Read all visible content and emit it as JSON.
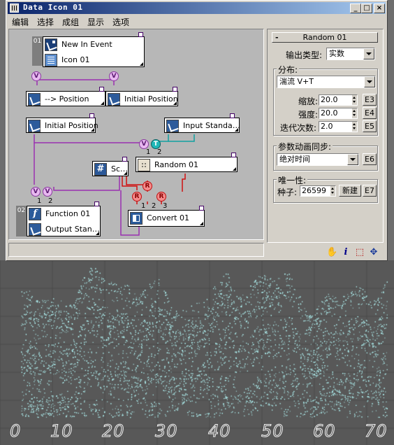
{
  "window": {
    "title": "Data Icon 01"
  },
  "menu": [
    "编辑",
    "选择",
    "成组",
    "显示",
    "选项"
  ],
  "graph": {
    "groups": [
      "01",
      "02"
    ],
    "nodes": {
      "new_in_event": "New In Event",
      "icon01": "Icon 01",
      "position": "--> Position",
      "initial_position_top": "Initial Position",
      "initial_position_left": "Initial Position",
      "input_standard": "Input Standa…",
      "scalar": "Sc…",
      "random": "Random 01",
      "function": "Function 01",
      "output_standard": "Output Stan…",
      "convert": "Convert 01"
    },
    "bubbles": {
      "v": "V",
      "t": "T",
      "r": "R"
    },
    "port_numbers": [
      "1",
      "2",
      "1",
      "2",
      "1",
      "2",
      "3"
    ]
  },
  "panel": {
    "header": "Random 01",
    "collapse": "-",
    "output_type_label": "输出类型:",
    "output_type_value": "实数",
    "distribution_group": "分布:",
    "distribution_value": "湍流 V+T",
    "scale_label": "缩放:",
    "scale_value": "20.0",
    "scale_btn": "E3",
    "strength_label": "强度:",
    "strength_value": "20.0",
    "strength_btn": "E4",
    "iterations_label": "迭代次数:",
    "iterations_value": "2.0",
    "iterations_btn": "E5",
    "anim_group": "参数动画同步:",
    "anim_value": "绝对时间",
    "anim_btn": "E6",
    "unique_group": "唯一性:",
    "seed_label": "种子:",
    "seed_value": "26599",
    "new_btn": "新建",
    "seed_btn": "E7"
  },
  "status_icons": [
    "hand-icon",
    "info-icon",
    "region-select-icon",
    "navigate-icon"
  ],
  "status_glyphs": {
    "hand": "✋",
    "info": "i",
    "region": "⬚",
    "nav": "✥"
  },
  "viewport": {
    "ruler_numbers": [
      "0",
      "10",
      "20",
      "30",
      "40",
      "50",
      "60",
      "70"
    ],
    "point_color": "#b8ffff"
  }
}
